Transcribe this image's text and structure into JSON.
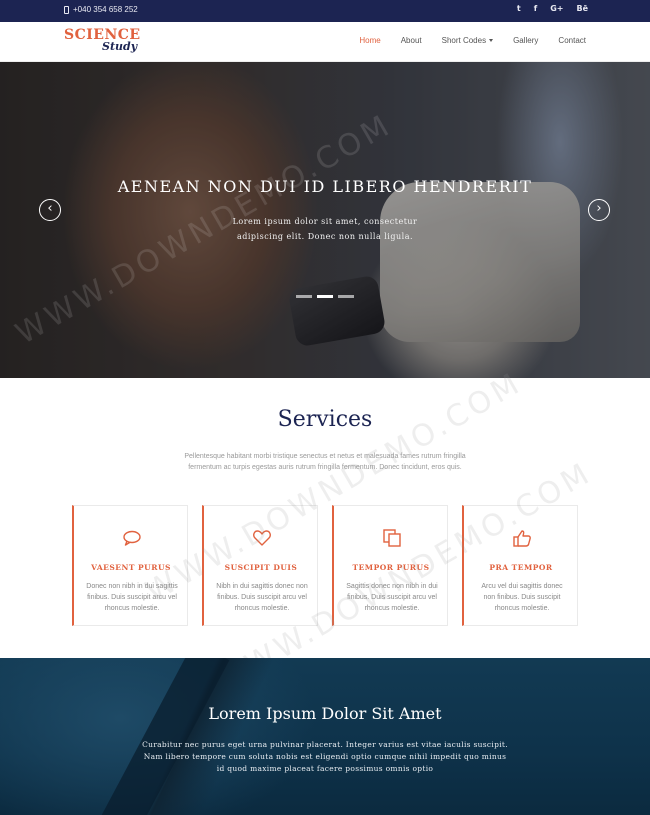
{
  "topbar": {
    "phone": "+040 354 658 252",
    "social": [
      "twitter-icon",
      "facebook-icon",
      "google-plus-icon",
      "behance-icon"
    ],
    "social_glyphs": [
      "t",
      "f",
      "G+",
      "Bē"
    ]
  },
  "logo": {
    "line1": "SCIENCE",
    "line2": "Study"
  },
  "nav": {
    "items": [
      "Home",
      "About",
      "Short Codes",
      "Gallery",
      "Contact"
    ],
    "active": "Home"
  },
  "hero": {
    "title": "AENEAN NON DUI ID LIBERO HENDRERIT",
    "subtitle": "Lorem ipsum dolor sit amet, consectetur adipiscing elit. Donec non nulla ligula.",
    "prev": "‹",
    "next": "›",
    "slide_count": 3,
    "active_slide": 2
  },
  "services": {
    "title": "Services",
    "intro": "Pellentesque habitant morbi tristique senectus et netus et malesuada fames rutrum fringilla fermentum ac turpis egestas auris rutrum fringilla fermentum. Donec tincidunt, eros quis.",
    "cards": [
      {
        "icon": "speech-bubble-icon",
        "title": "VAESENT PURUS",
        "text": "Donec non nibh in dui sagittis finibus. Duis suscipit arcu vel rhoncus molestie."
      },
      {
        "icon": "heart-icon",
        "title": "SUSCIPIT DUIS",
        "text": "Nibh in dui sagittis donec non finibus. Duis suscipit arcu vel rhoncus molestie."
      },
      {
        "icon": "copy-icon",
        "title": "TEMPOR PURUS",
        "text": "Sagittis donec non nibh in dui finibus. Duis suscipit arcu vel rhoncus molestie."
      },
      {
        "icon": "thumbs-up-icon",
        "title": "PRA TEMPOR",
        "text": "Arcu vel dui sagittis donec non finibus. Duis suscipit rhoncus molestie."
      }
    ]
  },
  "banner": {
    "title": "Lorem Ipsum Dolor Sit Amet",
    "text": "Curabitur nec purus eget urna pulvinar placerat. Integer varius est vitae iaculis suscipit. Nam libero tempore cum soluta nobis est eligendi optio cumque nihil impedit quo minus id quod maxime placeat facere possimus omnis optio"
  },
  "watermark": "WWW.DOWNDEMO.COM",
  "colors": {
    "navy": "#1c2452",
    "accent": "#e1623f",
    "banner": "#0e324a"
  }
}
